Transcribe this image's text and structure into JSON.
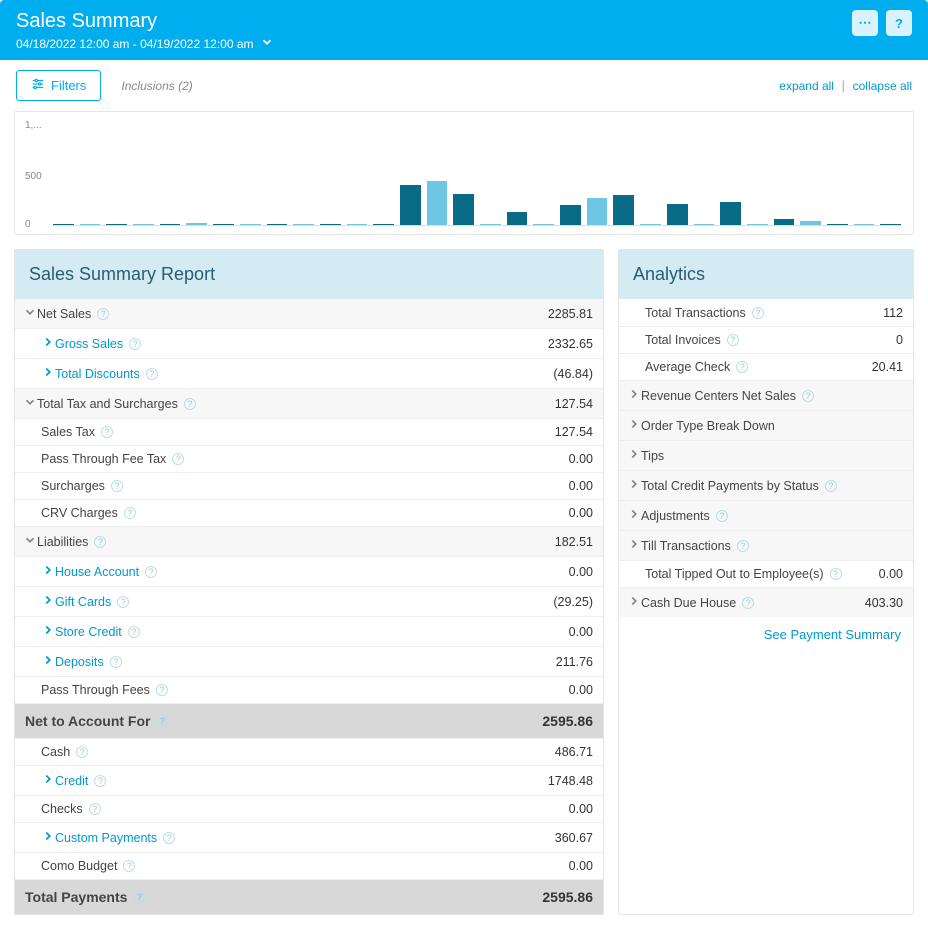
{
  "header": {
    "title": "Sales Summary",
    "date_range": "04/18/2022 12:00 am - 04/19/2022 12:00 am",
    "more_icon": "⋯",
    "help_icon": "?"
  },
  "toolbar": {
    "filters_label": "Filters",
    "inclusions_label": "Inclusions (2)",
    "expand_all": "expand all",
    "collapse_all": "collapse all"
  },
  "chart_data": {
    "type": "bar",
    "ylim": [
      0,
      1000
    ],
    "yticks": [
      "1,...",
      "500",
      "0"
    ],
    "series_colors": [
      "#0a6b86",
      "#6ec6e4"
    ],
    "values": [
      5,
      10,
      0,
      5,
      0,
      20,
      0,
      5,
      0,
      15,
      0,
      8,
      0,
      400,
      440,
      310,
      0,
      130,
      0,
      200,
      270,
      300,
      0,
      210,
      0,
      230,
      0,
      60,
      40,
      5,
      10,
      5
    ],
    "alt": [
      "dark",
      "light",
      "dark",
      "light",
      "dark",
      "light",
      "dark",
      "light",
      "dark",
      "light",
      "dark",
      "light",
      "dark",
      "dark",
      "light",
      "dark",
      "light",
      "dark",
      "light",
      "dark",
      "light",
      "dark",
      "light",
      "dark",
      "light",
      "dark",
      "light",
      "dark",
      "light",
      "dark",
      "light",
      "dark"
    ]
  },
  "left_panel": {
    "title": "Sales Summary Report",
    "rows": [
      {
        "kind": "section",
        "chev": "down",
        "label": "Net Sales",
        "help": true,
        "value": "2285.81"
      },
      {
        "kind": "sub",
        "chev": "right",
        "label": "Gross Sales",
        "help": true,
        "value": "2332.65",
        "link": true
      },
      {
        "kind": "sub",
        "chev": "right",
        "label": "Total Discounts",
        "help": true,
        "value": "(46.84)",
        "link": true
      },
      {
        "kind": "section",
        "chev": "down",
        "label": "Total Tax and Surcharges",
        "help": true,
        "value": "127.54"
      },
      {
        "kind": "plain",
        "label": "Sales Tax",
        "help": true,
        "value": "127.54"
      },
      {
        "kind": "plain",
        "label": "Pass Through Fee Tax",
        "help": true,
        "value": "0.00"
      },
      {
        "kind": "plain",
        "label": "Surcharges",
        "help": true,
        "value": "0.00"
      },
      {
        "kind": "plain",
        "label": "CRV Charges",
        "help": true,
        "value": "0.00"
      },
      {
        "kind": "section",
        "chev": "down",
        "label": "Liabilities",
        "help": true,
        "value": "182.51"
      },
      {
        "kind": "sub",
        "chev": "right",
        "label": "House Account",
        "help": true,
        "value": "0.00",
        "link": true
      },
      {
        "kind": "sub",
        "chev": "right",
        "label": "Gift Cards",
        "help": true,
        "value": "(29.25)",
        "link": true
      },
      {
        "kind": "sub",
        "chev": "right",
        "label": "Store Credit",
        "help": true,
        "value": "0.00",
        "link": true
      },
      {
        "kind": "sub",
        "chev": "right",
        "label": "Deposits",
        "help": true,
        "value": "211.76",
        "link": true
      },
      {
        "kind": "plain",
        "label": "Pass Through Fees",
        "help": true,
        "value": "0.00"
      },
      {
        "kind": "total",
        "label": "Net to Account For",
        "help": true,
        "value": "2595.86"
      },
      {
        "kind": "plain",
        "label": "Cash",
        "help": true,
        "value": "486.71"
      },
      {
        "kind": "sub",
        "chev": "right",
        "label": "Credit",
        "help": true,
        "value": "1748.48",
        "link": true
      },
      {
        "kind": "plain",
        "label": "Checks",
        "help": true,
        "value": "0.00"
      },
      {
        "kind": "sub",
        "chev": "right",
        "label": "Custom Payments",
        "help": true,
        "value": "360.67",
        "link": true
      },
      {
        "kind": "plain",
        "label": "Como Budget",
        "help": true,
        "value": "0.00"
      },
      {
        "kind": "total",
        "label": "Total Payments",
        "help": true,
        "value": "2595.86"
      }
    ]
  },
  "right_panel": {
    "title": "Analytics",
    "rows": [
      {
        "kind": "plain",
        "label": "Total Transactions",
        "help": true,
        "value": "112"
      },
      {
        "kind": "plain",
        "label": "Total Invoices",
        "help": true,
        "value": "0"
      },
      {
        "kind": "plain",
        "label": "Average Check",
        "help": true,
        "value": "20.41"
      },
      {
        "kind": "subhead",
        "chev": "right",
        "label": "Revenue Centers Net Sales",
        "help": true,
        "value": ""
      },
      {
        "kind": "subhead",
        "chev": "right",
        "label": "Order Type Break Down",
        "value": ""
      },
      {
        "kind": "subhead",
        "chev": "right",
        "label": "Tips",
        "value": ""
      },
      {
        "kind": "subhead",
        "chev": "right",
        "label": "Total Credit Payments by Status",
        "help": true,
        "value": ""
      },
      {
        "kind": "subhead",
        "chev": "right",
        "label": "Adjustments",
        "help": true,
        "value": ""
      },
      {
        "kind": "subhead",
        "chev": "right",
        "label": "Till Transactions",
        "help": true,
        "value": ""
      },
      {
        "kind": "plain",
        "label": "Total Tipped Out to Employee(s)",
        "help": true,
        "value": "0.00"
      },
      {
        "kind": "subhead",
        "chev": "right",
        "label": "Cash Due House",
        "help": true,
        "value": "403.30"
      }
    ],
    "footer_link": "See Payment Summary"
  }
}
